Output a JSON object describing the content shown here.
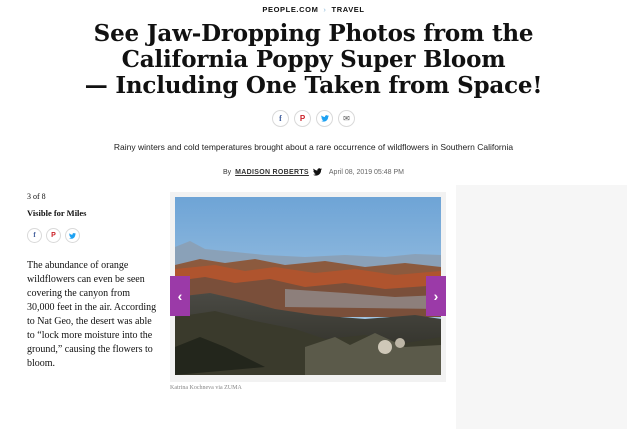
{
  "breadcrumb": {
    "site": "PEOPLE.COM",
    "section": "TRAVEL"
  },
  "headline": {
    "line1": "See Jaw-Dropping Photos from the",
    "line2": "California Poppy Super Bloom",
    "line3": "— Including One Taken from Space!"
  },
  "share_top": {
    "facebook": "f",
    "pinterest": "P",
    "twitter": "t",
    "email": "✉"
  },
  "dek": "Rainy winters and cold temperatures brought about a rare occurrence of wildflowers in Southern California",
  "byline": {
    "by": "By",
    "author": "MADISON ROBERTS",
    "date": "April 08, 2019 05:48 PM"
  },
  "slide": {
    "counter": "3 of 8",
    "title": "Visible for Miles",
    "caption": "The abundance of orange wildflowers can even be seen covering the canyon from 30,000 feet in the air. According to Nat Geo, the desert was able to “lock more moisture into the ground,” causing the flowers to bloom.",
    "credit": "Katrina Kochneva via ZUMA",
    "prev_icon": "chevron-left",
    "next_icon": "chevron-right"
  },
  "colors": {
    "accent": "#9b3aa8",
    "facebook": "#3b5998",
    "pinterest": "#cb2027",
    "twitter": "#1da1f2"
  }
}
